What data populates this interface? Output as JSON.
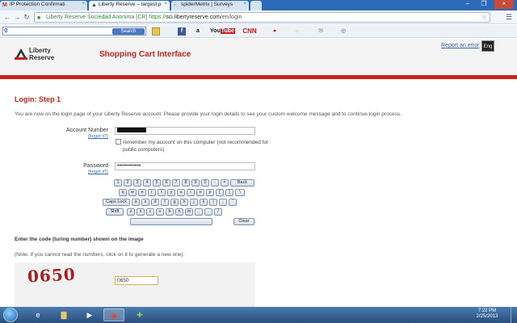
{
  "browser": {
    "tabs": [
      {
        "label": "IP Protection Confirmati",
        "icon": "gmail-icon",
        "active": false
      },
      {
        "label": "Liberty Reserve – largest p",
        "icon": "liberty-reserve-icon",
        "active": true
      },
      {
        "label": "spiderMetrix | Surveys",
        "icon": "page-icon",
        "active": false
      }
    ],
    "address": {
      "ev_name": "Liberty Reserve Sociedad Anonima [CR]",
      "scheme": "https://",
      "host": "sci.libertyreserve.com",
      "path": "/en/login"
    },
    "toolbar": {
      "search_button": "Search",
      "icons": [
        "facebook-icon",
        "amazon-icon",
        "youtube-icon",
        "cnn-icon",
        "ladybug-icon",
        "weather-icon",
        "mail-icon",
        "radar-icon"
      ],
      "youtube_label": "YouTube",
      "cnn_label": "CNN"
    }
  },
  "header": {
    "logo_line1": "Liberty",
    "logo_line2": "Reserve",
    "title": "Shopping Cart Interface",
    "report_link": "Report an error",
    "lang": "Eng"
  },
  "login": {
    "heading": "Login: Step 1",
    "intro": "You are now on the login page of your Liberty Reserve account. Please provide your login details to see your custom welcome message and to continue login process.",
    "account_label": "Account Number",
    "forgot_label": "(forgot it?)",
    "remember_text": "remember my account on this computer (not recommended for public computers)",
    "password_label": "Password",
    "password_value": "••••••••••••",
    "password_forgot": "(forgot it?)"
  },
  "keyboard": {
    "row1": [
      "1",
      "2",
      "3",
      "4",
      "5",
      "6",
      "7",
      "8",
      "9",
      "0",
      "-",
      "=",
      "Back"
    ],
    "row2": [
      "q",
      "w",
      "e",
      "r",
      "t",
      "y",
      "u",
      "i",
      "o",
      "p",
      "[",
      "]",
      "\\"
    ],
    "row3": [
      "Caps Lock",
      "a",
      "s",
      "d",
      "f",
      "g",
      "h",
      "j",
      "k",
      "l",
      ";",
      "'"
    ],
    "row4": [
      "Shift",
      "z",
      "x",
      "c",
      "v",
      "b",
      "n",
      "m",
      ",",
      ".",
      "/"
    ],
    "clear": "Clear"
  },
  "code": {
    "heading": "Enter the code (turing number) shown on the image",
    "note": "(Note: If you cannot read the numbers, click on it to generate a new one):",
    "captcha_text": "0650",
    "input_value": "0650"
  },
  "taskbar": {
    "time": "7:22 PM",
    "date": "2/25/2013"
  }
}
